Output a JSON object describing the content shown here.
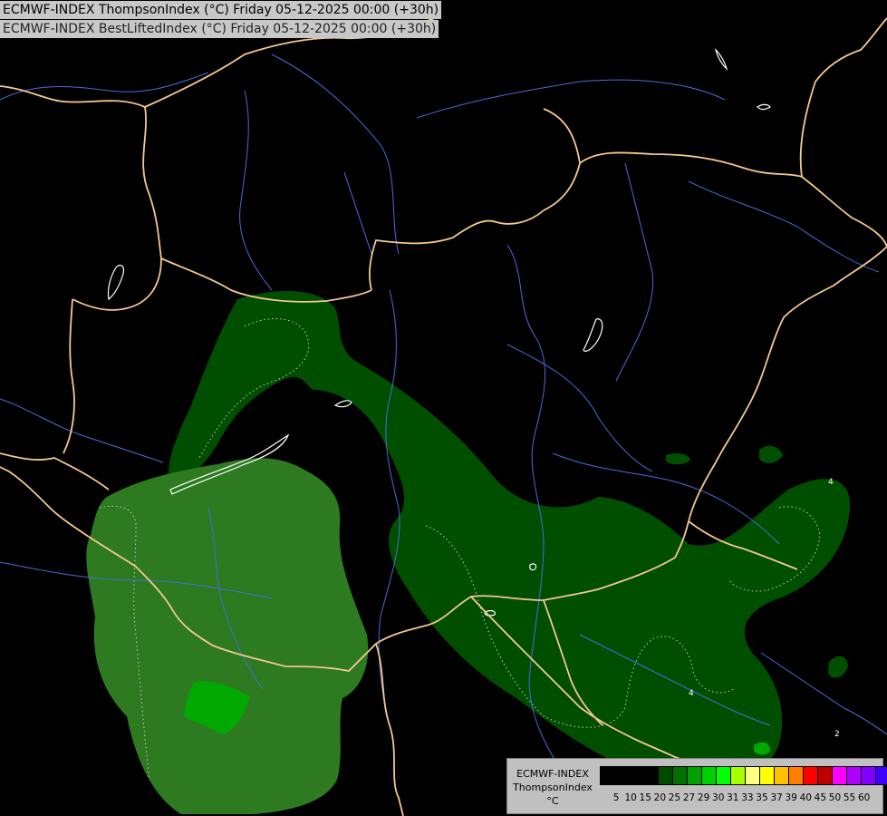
{
  "titles": {
    "line1": "ECMWF-INDEX ThompsonIndex (°C) Friday 05-12-2025 00:00 (+30h)",
    "line2": "ECMWF-INDEX BestLiftedIndex (°C) Friday 05-12-2025 00:00 (+30h)"
  },
  "legend": {
    "label_model": "ECMWF-INDEX",
    "label_param": "ThompsonIndex",
    "label_unit": "°C",
    "colors": [
      "#000000",
      "#000000",
      "#000000",
      "#000000",
      "#004a00",
      "#007000",
      "#00a000",
      "#00d000",
      "#00ff00",
      "#a8ff00",
      "#ffff80",
      "#ffff00",
      "#ffc000",
      "#ff8000",
      "#ff0000",
      "#c00000",
      "#ff00ff",
      "#b000ff",
      "#8000ff",
      "#4000ff",
      "#0000ff"
    ],
    "ticks": [
      "5",
      "10",
      "15",
      "20",
      "25",
      "27",
      "29",
      "30",
      "31",
      "33",
      "35",
      "37",
      "39",
      "40",
      "45",
      "50",
      "55",
      "60"
    ]
  },
  "map_colors": {
    "background": "#000000",
    "field_dark": "#004f00",
    "field_mid": "#2d7a20",
    "field_bright": "#00a800",
    "borders": "#f4c890",
    "rivers": "#4a6bd8",
    "lakes": "#ffffff",
    "contours": "#c8c8c8"
  }
}
